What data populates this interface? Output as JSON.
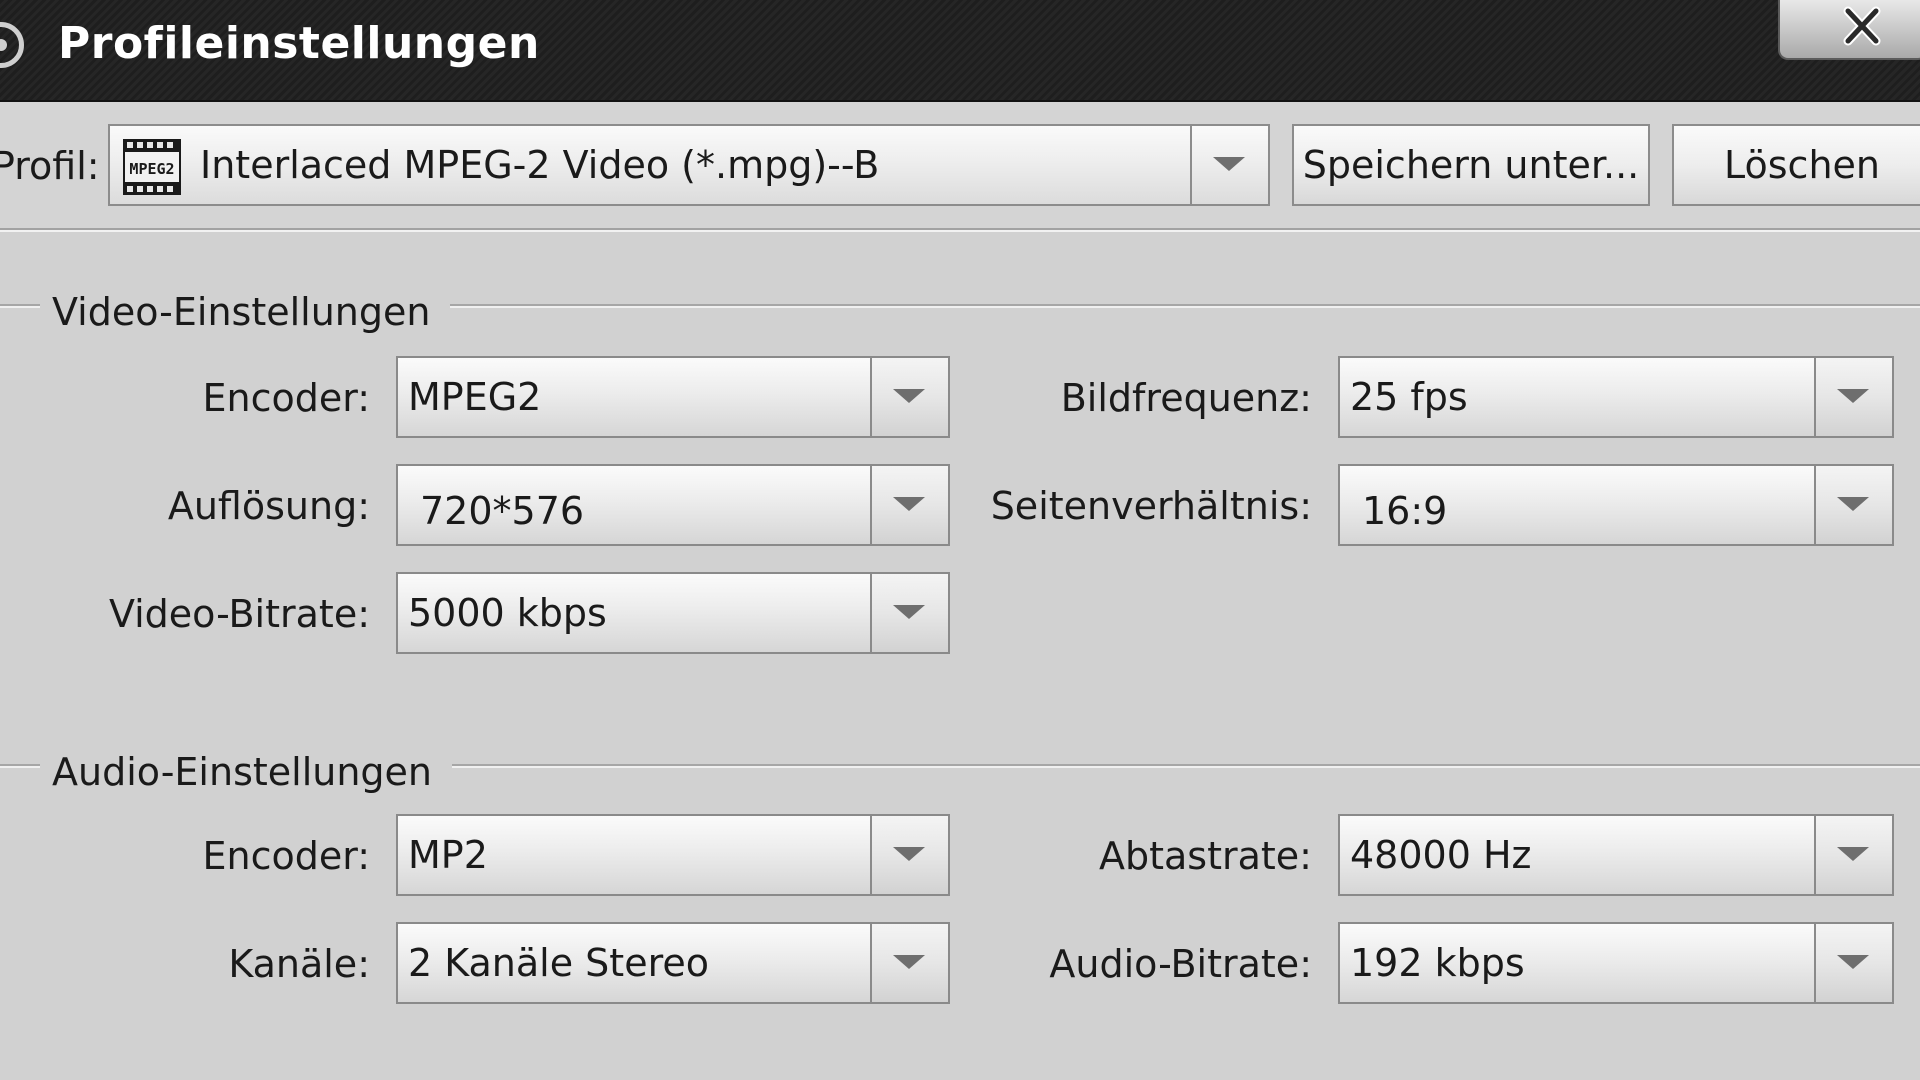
{
  "window": {
    "title": "Profileinstellungen",
    "close_label": "X",
    "app_icon": "disc-icon",
    "close_icon": "close-icon"
  },
  "profile": {
    "label": "Profil:",
    "selected": "Interlaced MPEG-2 Video (*.mpg)--B",
    "icon": "mpeg-file-icon",
    "icon_text": "MPEG2",
    "save_as_label": "Speichern unter...",
    "delete_label": "Löschen"
  },
  "video": {
    "group_title": "Video-Einstellungen",
    "encoder": {
      "label": "Encoder:",
      "value": "MPEG2"
    },
    "resolution": {
      "label": "Auflösung:",
      "value": "720*576"
    },
    "bitrate": {
      "label": "Video-Bitrate:",
      "value": "5000 kbps"
    },
    "framerate": {
      "label": "Bildfrequenz:",
      "value": "25 fps"
    },
    "aspect": {
      "label": "Seitenverhältnis:",
      "value": "16:9"
    }
  },
  "audio": {
    "group_title": "Audio-Einstellungen",
    "encoder": {
      "label": "Encoder:",
      "value": "MP2"
    },
    "channels": {
      "label": "Kanäle:",
      "value": "2 Kanäle Stereo"
    },
    "samplerate": {
      "label": "Abtastrate:",
      "value": "48000 Hz"
    },
    "bitrate": {
      "label": "Audio-Bitrate:",
      "value": "192 kbps"
    }
  },
  "colors": {
    "titlebar": "#1e1e1e",
    "background": "#d1d1d1",
    "text": "#1a1a1a",
    "title_text": "#ffffff"
  }
}
